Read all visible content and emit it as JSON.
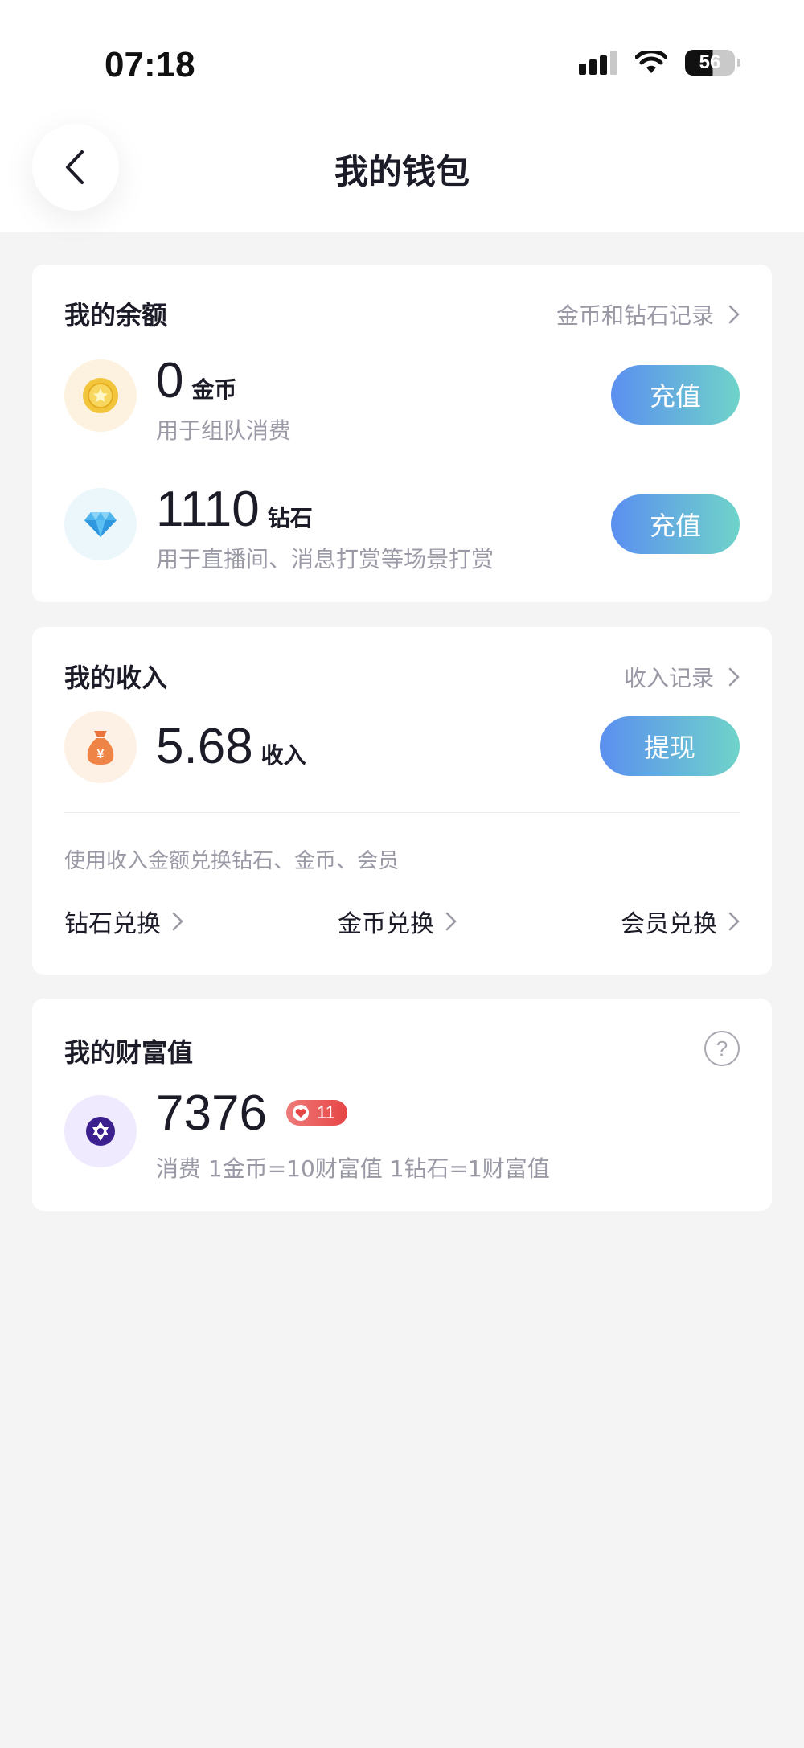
{
  "status_bar": {
    "time": "07:18",
    "battery": "56"
  },
  "header": {
    "title": "我的钱包"
  },
  "balance": {
    "title": "我的余额",
    "records_link": "金币和钻石记录",
    "coins": {
      "amount": "0",
      "unit": "金币",
      "description": "用于组队消费",
      "button": "充值"
    },
    "diamonds": {
      "amount": "1110",
      "unit": "钻石",
      "description": "用于直播间、消息打赏等场景打赏",
      "button": "充值"
    }
  },
  "income": {
    "title": "我的收入",
    "records_link": "收入记录",
    "amount": "5.68",
    "unit": "收入",
    "withdraw_button": "提现",
    "exchange_hint": "使用收入金额兑换钻石、金币、会员",
    "exchanges": [
      "钻石兑换",
      "金币兑换",
      "会员兑换"
    ]
  },
  "wealth": {
    "title": "我的财富值",
    "help": "?",
    "value": "7376",
    "level": "11",
    "rule": "消费 1金币=10财富值 1钻石=1财富值"
  },
  "colors": {
    "accent_gradient_start": "#5b8ff0",
    "accent_gradient_end": "#6fd3c9",
    "level_badge": "#e64545",
    "background": "#f4f4f5"
  },
  "icons": {
    "coin": "gold-coin-icon",
    "diamond": "diamond-icon",
    "income": "money-bag-icon",
    "wealth": "wealth-star-icon"
  }
}
